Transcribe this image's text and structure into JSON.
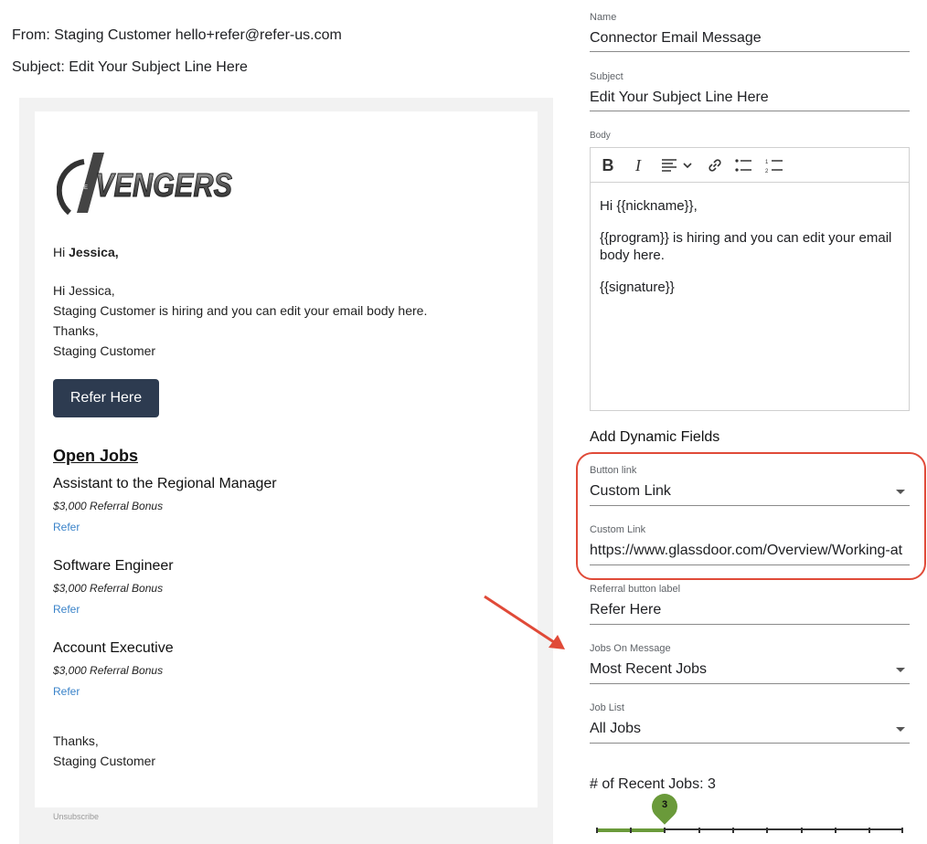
{
  "header": {
    "from": "From: Staging Customer hello+refer@refer-us.com",
    "subject": "Subject: Edit Your Subject Line Here"
  },
  "preview": {
    "logo_text": "AVENGERS",
    "greeting_prefix": "Hi ",
    "greeting_name": "Jessica,",
    "body_lines": [
      "Hi Jessica,",
      "Staging Customer is hiring and you can edit your email body here.",
      "Thanks,",
      "Staging Customer"
    ],
    "refer_button": "Refer Here",
    "open_jobs_heading": "Open Jobs",
    "jobs": [
      {
        "title": "Assistant to the Regional Manager",
        "bonus": "$3,000 Referral Bonus",
        "link": "Refer"
      },
      {
        "title": "Software Engineer",
        "bonus": "$3,000 Referral Bonus",
        "link": "Refer"
      },
      {
        "title": "Account Executive",
        "bonus": "$3,000 Referral Bonus",
        "link": "Refer"
      }
    ],
    "signoff": [
      "Thanks,",
      "Staging Customer"
    ],
    "unsubscribe": "Unsubscribe"
  },
  "form": {
    "name_label": "Name",
    "name_value": "Connector Email Message",
    "subject_label": "Subject",
    "subject_value": "Edit Your Subject Line Here",
    "body_label": "Body",
    "body_paragraphs": [
      "Hi {{nickname}},",
      "{{program}} is hiring and you can edit your email body here.",
      "{{signature}}"
    ],
    "dynamic_fields_title": "Add Dynamic Fields",
    "button_link_label": "Button link",
    "button_link_value": "Custom Link",
    "custom_link_label": "Custom Link",
    "custom_link_value": "https://www.glassdoor.com/Overview/Working-at",
    "referral_label_label": "Referral button label",
    "referral_label_value": "Refer Here",
    "jobs_on_message_label": "Jobs On Message",
    "jobs_on_message_value": "Most Recent Jobs",
    "job_list_label": "Job List",
    "job_list_value": "All Jobs",
    "recent_jobs_label": "# of Recent Jobs: 3",
    "recent_jobs_value": "3",
    "recent_jobs_level": 3
  },
  "colors": {
    "annotation": "#e04a38",
    "button": "#2d3b50",
    "link": "#3a83c9",
    "slider": "#6a9a3a"
  }
}
